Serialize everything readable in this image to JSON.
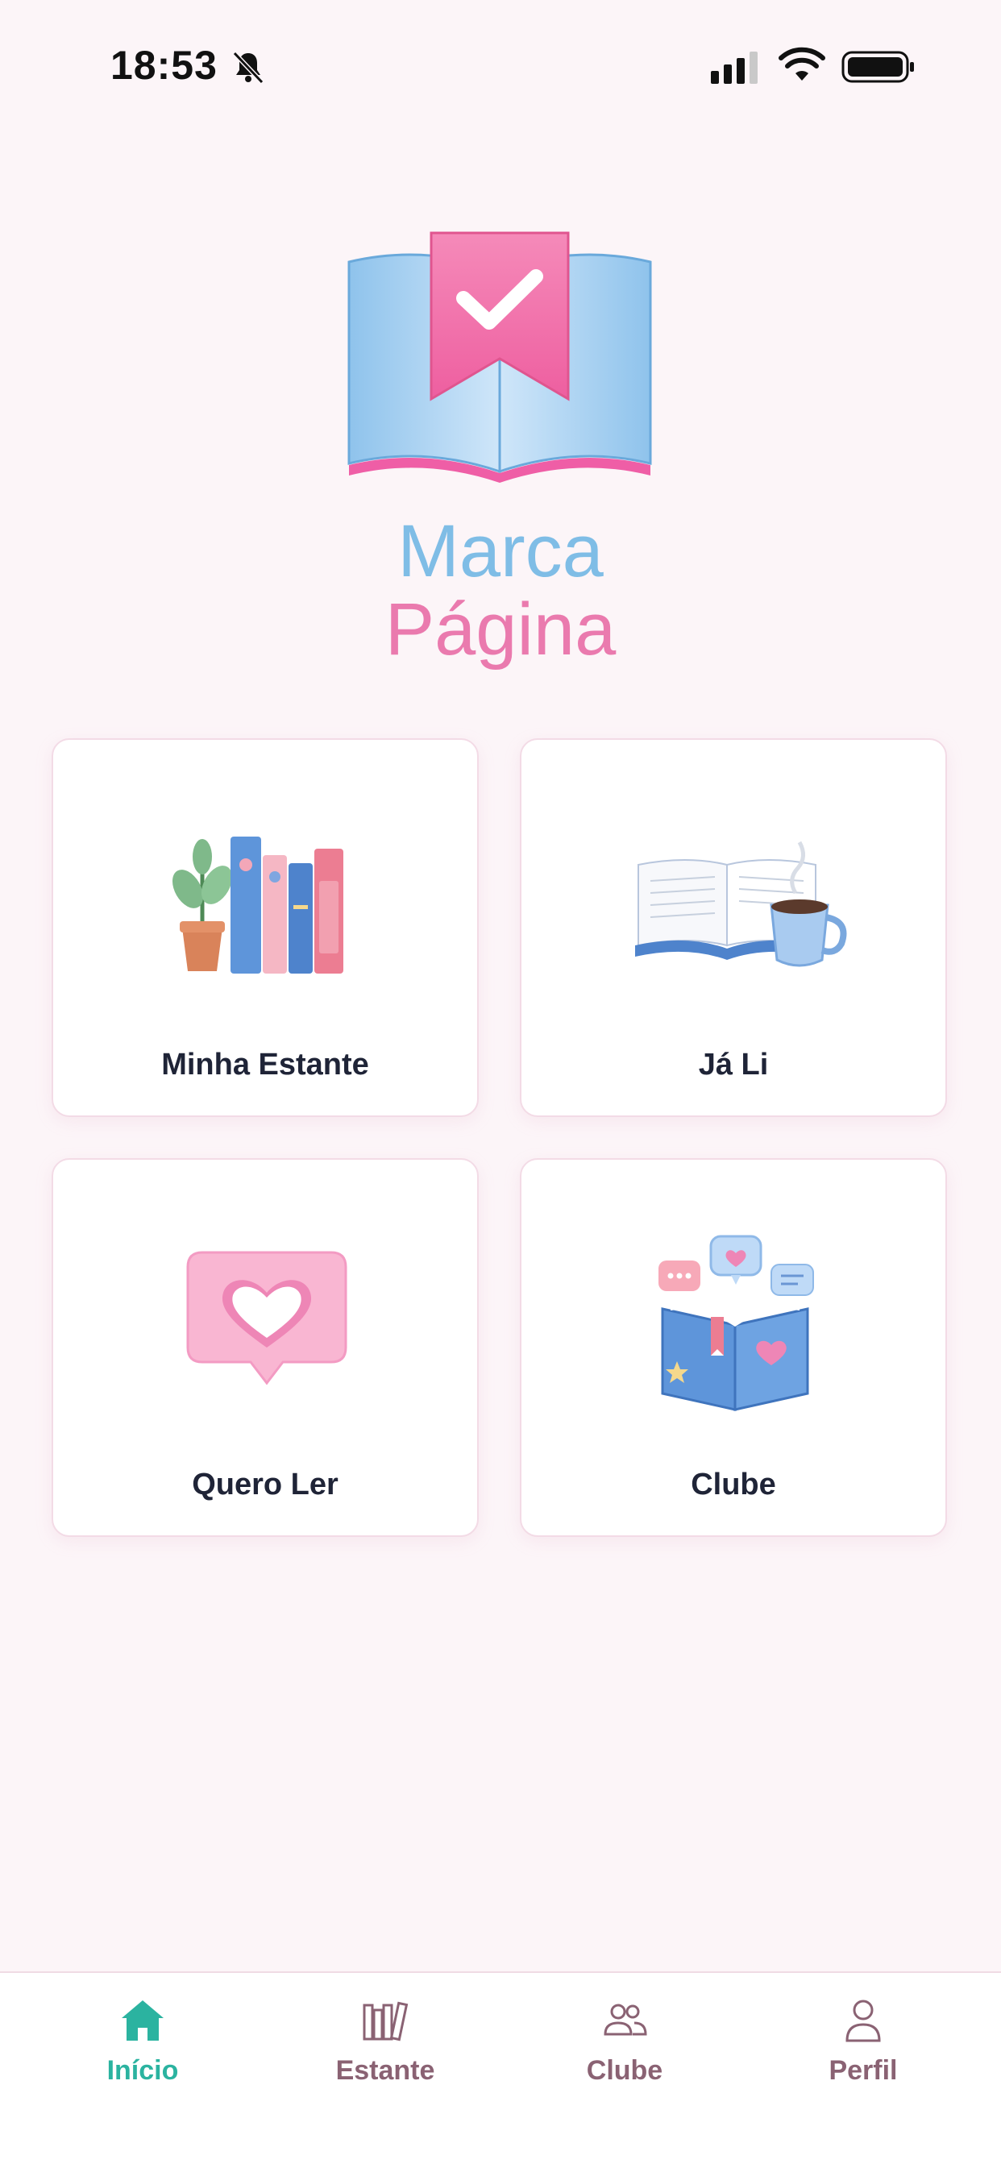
{
  "status_bar": {
    "time": "18:53",
    "icons": [
      "bell-slash-icon",
      "cellular-signal-icon",
      "wifi-icon",
      "battery-icon"
    ]
  },
  "app": {
    "brand_line1": "Marca",
    "brand_line2": "Página",
    "logo_icon": "open-book-bookmark-check-icon"
  },
  "cards": [
    {
      "label": "Minha Estante",
      "icon": "bookshelf-plant-icon"
    },
    {
      "label": "Já Li",
      "icon": "open-book-coffee-icon"
    },
    {
      "label": "Quero Ler",
      "icon": "heart-speech-bubble-icon"
    },
    {
      "label": "Clube",
      "icon": "book-chat-bubbles-icon"
    }
  ],
  "bottom_nav": {
    "items": [
      {
        "label": "Início",
        "icon": "home-icon",
        "active": true
      },
      {
        "label": "Estante",
        "icon": "bookshelf-icon",
        "active": false
      },
      {
        "label": "Clube",
        "icon": "users-icon",
        "active": false
      },
      {
        "label": "Perfil",
        "icon": "user-icon",
        "active": false
      }
    ]
  },
  "colors": {
    "background": "#fcf5f8",
    "brand_blue": "#7fbde6",
    "brand_pink": "#ea7aae",
    "active_nav": "#2bb3a0",
    "inactive_nav": "#8a6273"
  }
}
